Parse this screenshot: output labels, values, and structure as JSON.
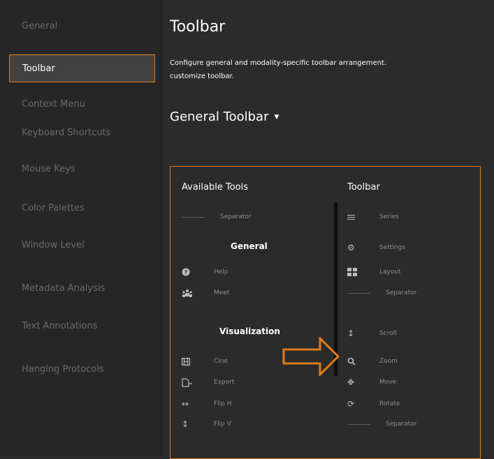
{
  "sidebar": {
    "items": [
      {
        "label": "General"
      },
      {
        "label": "Toolbar",
        "active": true
      },
      {
        "label": "Context Menu"
      },
      {
        "label": "Keyboard Shortcuts"
      },
      {
        "label": "Mouse Keys"
      },
      {
        "label": "Color Palettes"
      },
      {
        "label": "Window Level"
      },
      {
        "label": "Metadata Analysis"
      },
      {
        "label": "Text Annotations"
      },
      {
        "label": "Hanging Protocols"
      }
    ]
  },
  "main": {
    "title": "Toolbar",
    "description": "Configure general and modality-specific toolbar arrangement.\ncustomize toolbar.",
    "toolbar_select": "General Toolbar"
  },
  "panel": {
    "available_heading": "Available Tools",
    "toolbar_heading": "Toolbar",
    "available": {
      "separator": "Separator",
      "general_heading": "General",
      "general": [
        {
          "label": "Help",
          "icon": "help-icon"
        },
        {
          "label": "Meet",
          "icon": "meet-icon"
        }
      ],
      "visualization_heading": "Visualization",
      "visualization": [
        {
          "label": "Cine",
          "icon": "cine-icon"
        },
        {
          "label": "Export",
          "icon": "export-icon"
        },
        {
          "label": "Flip H",
          "icon": "flip-h-icon"
        },
        {
          "label": "Flip V",
          "icon": "flip-v-icon"
        }
      ]
    },
    "toolbar": [
      {
        "label": "Series",
        "icon": "series-icon"
      },
      {
        "label": "Settings",
        "icon": "settings-icon"
      },
      {
        "label": "Layout",
        "icon": "layout-icon"
      },
      {
        "label": "Separator",
        "icon": "separator"
      },
      {
        "label": "Scroll",
        "icon": "scroll-icon"
      },
      {
        "label": "Zoom",
        "icon": "zoom-icon"
      },
      {
        "label": "Move",
        "icon": "move-icon"
      },
      {
        "label": "Rotate",
        "icon": "rotate-icon"
      },
      {
        "label": "Separator",
        "icon": "separator"
      }
    ]
  },
  "colors": {
    "accent": "#e07b1a",
    "sidebar_bg": "#262626",
    "content_bg": "#2b2b2b",
    "active_bg": "#424242"
  }
}
